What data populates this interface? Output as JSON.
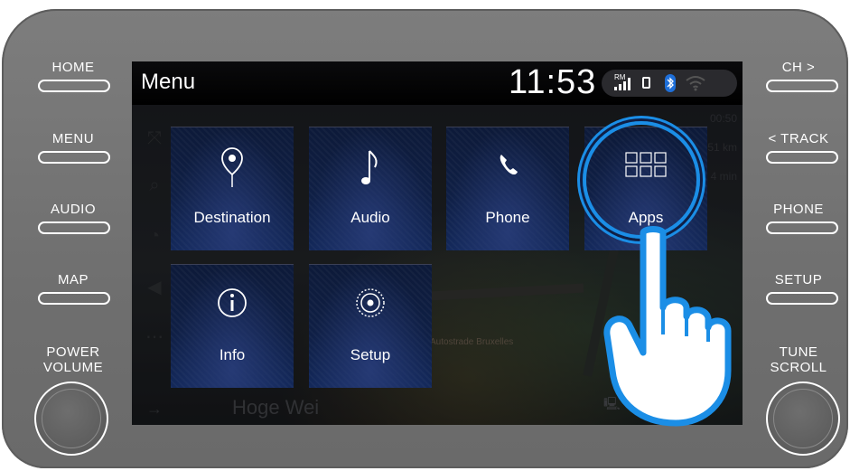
{
  "hardware": {
    "left_buttons": [
      {
        "label": "HOME"
      },
      {
        "label": "MENU"
      },
      {
        "label": "AUDIO"
      },
      {
        "label": "MAP"
      }
    ],
    "right_buttons": [
      {
        "label": "CH >"
      },
      {
        "label": "< TRACK"
      },
      {
        "label": "PHONE"
      },
      {
        "label": "SETUP"
      }
    ],
    "left_knob": {
      "line1": "POWER",
      "line2": "VOLUME"
    },
    "right_knob": {
      "line1": "TUNE",
      "line2": "SCROLL"
    }
  },
  "screen": {
    "title": "Menu",
    "clock": "11:53",
    "status": {
      "rm_label": "RM",
      "icons": [
        "signal-icon",
        "battery-icon",
        "bluetooth-icon",
        "wifi-icon"
      ],
      "bluetooth_color": "#1e6fd9"
    },
    "tiles": [
      {
        "label": "Destination",
        "icon": "map-pin-icon"
      },
      {
        "label": "Audio",
        "icon": "music-note-icon"
      },
      {
        "label": "Phone",
        "icon": "phone-icon"
      },
      {
        "label": "Apps",
        "icon": "apps-grid-icon",
        "highlighted": true
      },
      {
        "label": "Info",
        "icon": "info-icon"
      },
      {
        "label": "Setup",
        "icon": "setup-gear-icon"
      }
    ],
    "map": {
      "street": "Hoge Wei",
      "road_label": "Autostrade Bruxelles",
      "eta_time": "00:50",
      "distance": "51 km",
      "minutes": "4 min"
    }
  },
  "colors": {
    "highlight_ring": "#1b8ee6",
    "tile_bg": "#0f1f45",
    "bezel": "#757575"
  }
}
